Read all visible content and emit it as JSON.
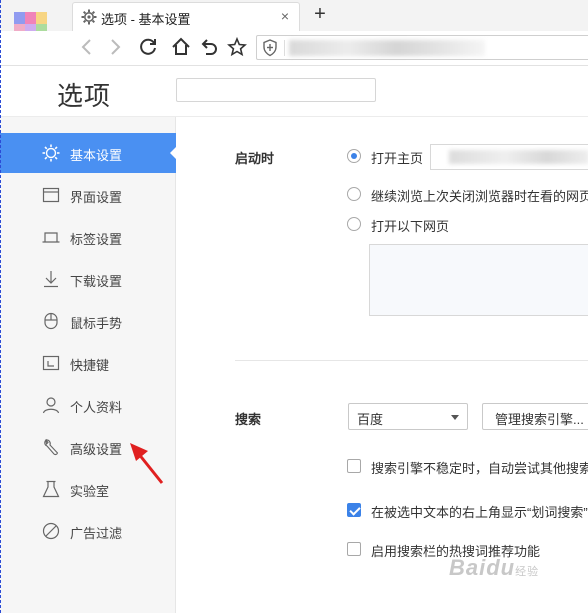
{
  "tab": {
    "title": "选项 - 基本设置",
    "close": "×",
    "new_tab": "+"
  },
  "toolbar": {
    "back": "back",
    "forward": "forward",
    "reload": "reload",
    "home": "home",
    "undo": "undo",
    "favorite": "favorite",
    "address_placeholder": ""
  },
  "header": {
    "title": "选项",
    "search_placeholder": ""
  },
  "sidebar": {
    "items": [
      {
        "label": "基本设置",
        "icon": "gear-icon",
        "active": true
      },
      {
        "label": "界面设置",
        "icon": "window-icon"
      },
      {
        "label": "标签设置",
        "icon": "tab-icon"
      },
      {
        "label": "下载设置",
        "icon": "download-icon"
      },
      {
        "label": "鼠标手势",
        "icon": "mouse-icon"
      },
      {
        "label": "快捷键",
        "icon": "shortcut-icon"
      },
      {
        "label": "个人资料",
        "icon": "user-icon"
      },
      {
        "label": "高级设置",
        "icon": "wrench-icon"
      },
      {
        "label": "实验室",
        "icon": "flask-icon"
      },
      {
        "label": "广告过滤",
        "icon": "block-icon"
      }
    ]
  },
  "startup": {
    "label": "启动时",
    "options": [
      "打开主页",
      "继续浏览上次关闭浏览器时在看的网页",
      "打开以下网页"
    ],
    "selected": 0
  },
  "search": {
    "label": "搜索",
    "engine": "百度",
    "manage_button": "管理搜索引擎...",
    "checkboxes": [
      {
        "label": "搜索引擎不稳定时，自动尝试其他搜索引擎",
        "checked": false
      },
      {
        "label": "在被选中文本的右上角显示“划词搜索”按钮",
        "checked": true
      },
      {
        "label": "启用搜索栏的热搜词推荐功能",
        "checked": false
      }
    ]
  },
  "watermark": {
    "text": "Baidu",
    "sub": "经验"
  },
  "colors": {
    "accent": "#4a90f2",
    "annotation_arrow": "#e02020"
  }
}
